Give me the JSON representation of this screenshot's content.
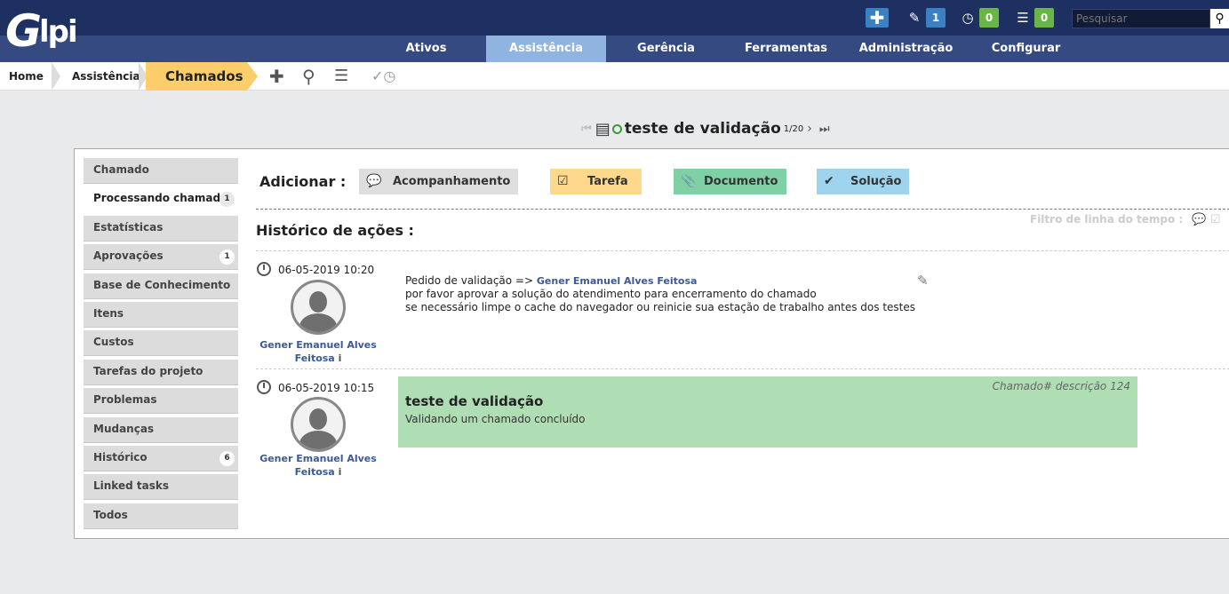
{
  "app": {
    "logo": "Glpi"
  },
  "topbar": {
    "plus_label": "✚",
    "ticket_count": "1",
    "reminder_count": "0",
    "list_count": "0",
    "search_placeholder": "Pesquisar",
    "colors": {
      "blue": "#3b80c3",
      "green": "#69b545"
    }
  },
  "nav": {
    "items": [
      "Ativos",
      "Assistência",
      "Gerência",
      "Ferramentas",
      "Administração",
      "Configurar"
    ],
    "active": "Assistência"
  },
  "breadcrumb": {
    "home": "Home",
    "section": "Assistência",
    "current": "Chamados"
  },
  "pager": {
    "title": "teste de validação",
    "position": "1/20"
  },
  "sidebar": {
    "items": [
      {
        "label": "Chamado",
        "badge": ""
      },
      {
        "label": "Processando chamado",
        "badge": "1"
      },
      {
        "label": "Estatísticas",
        "badge": ""
      },
      {
        "label": "Aprovações",
        "badge": "1"
      },
      {
        "label": "Base de Conhecimento",
        "badge": ""
      },
      {
        "label": "Itens",
        "badge": ""
      },
      {
        "label": "Custos",
        "badge": ""
      },
      {
        "label": "Tarefas do projeto",
        "badge": ""
      },
      {
        "label": "Problemas",
        "badge": ""
      },
      {
        "label": "Mudanças",
        "badge": ""
      },
      {
        "label": "Histórico",
        "badge": "6"
      },
      {
        "label": "Linked tasks",
        "badge": ""
      },
      {
        "label": "Todos",
        "badge": ""
      }
    ],
    "selected": "Processando chamado"
  },
  "add": {
    "label": "Adicionar :",
    "buttons": [
      {
        "label": "Acompanhamento",
        "color": "#dedede"
      },
      {
        "label": "Tarefa",
        "color": "#fed98d"
      },
      {
        "label": "Documento",
        "color": "#80d0a5"
      },
      {
        "label": "Solução",
        "color": "#9ed4ee"
      }
    ]
  },
  "timeline": {
    "title": "Histórico de ações :",
    "filter_label": "Filtro de linha do tempo :",
    "entries": [
      {
        "date": "06-05-2019 10:20",
        "user_line1": "Gener Emanuel Alves",
        "user_line2": "Feitosa",
        "info": "i",
        "line1_prefix": "Pedido de validação =>",
        "line1_user": "Gener Emanuel Alves Feitosa",
        "line2": "por favor aprovar a solução do atendimento para encerramento do chamado",
        "line3": "se necessário limpe o cache do navegador ou reinicie sua estação de trabalho antes dos testes"
      },
      {
        "date": "06-05-2019 10:15",
        "user_line1": "Gener Emanuel Alves",
        "user_line2": "Feitosa",
        "info": "i",
        "title": "teste de validação",
        "desc": "Validando um chamado concluído",
        "ref": "Chamado# descrição 124"
      }
    ]
  }
}
